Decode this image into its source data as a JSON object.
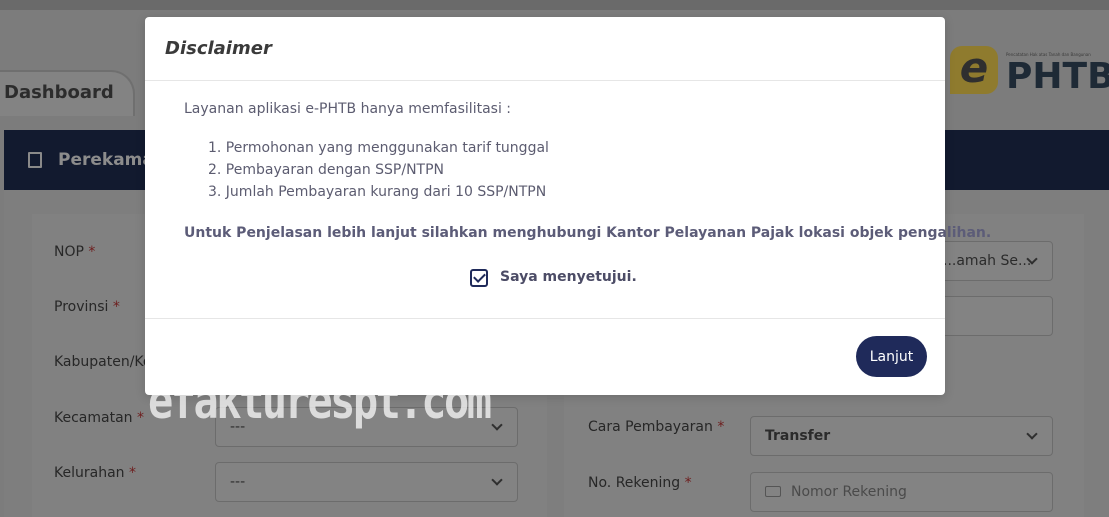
{
  "background": {
    "dashboard_tab": "Dashboard",
    "logo": {
      "prefix": "e",
      "text": "PHTB",
      "small_text": "Pencatatan Hak atas Tanah dan Bangunan"
    },
    "section_title": "Perekaman",
    "left_fields": [
      {
        "label": "NOP",
        "required": "*"
      },
      {
        "label": "Provinsi",
        "required": "*"
      },
      {
        "label": "Kabupaten/Kota",
        "required": "*"
      },
      {
        "label": "Kecamatan",
        "required": "*",
        "value": "---"
      },
      {
        "label": "Kelurahan",
        "required": "*",
        "value": "---"
      }
    ],
    "right_fields": {
      "top_select_value": "...amah Se...",
      "payment_method": {
        "label": "Cara Pembayaran",
        "required": "*",
        "value": "Transfer"
      },
      "account_number": {
        "label": "No. Rekening",
        "required": "*",
        "placeholder": "Nomor Rekening"
      }
    }
  },
  "modal": {
    "title": "Disclaimer",
    "intro": "Layanan aplikasi e-PHTB hanya memfasilitasi :",
    "items": [
      "1. Permohonan yang menggunakan tarif tunggal",
      "2. Pembayaran dengan SSP/NTPN",
      "3. Jumlah Pembayaran kurang dari 10 SSP/NTPN"
    ],
    "notice": "Untuk Penjelasan lebih lanjut silahkan menghubungi Kantor Pelayanan Pajak lokasi objek pengalihan.",
    "agree_label": "Saya menyetujui.",
    "agree_checked": true,
    "continue_label": "Lanjut"
  },
  "watermark": "efakturespt.com",
  "colors": {
    "primary": "#1f2a5a",
    "overlay": "#7c7c7c",
    "modal_bg": "#ffffff"
  }
}
